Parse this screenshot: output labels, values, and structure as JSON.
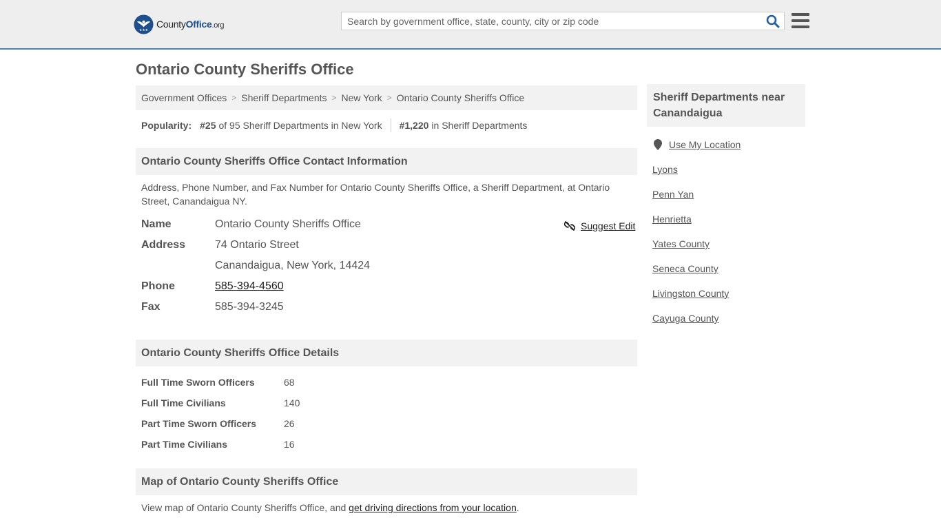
{
  "site": {
    "logo_text_part1": "County",
    "logo_text_part2": "Office",
    "logo_text_part3": ".org",
    "search_placeholder": "Search by government office, state, county, city or zip code",
    "brand_color": "#1f4e8c",
    "accent_border": "#4a83b8"
  },
  "page": {
    "title": "Ontario County Sheriffs Office"
  },
  "breadcrumb": [
    "Government Offices",
    "Sheriff Departments",
    "New York",
    "Ontario County Sheriffs Office"
  ],
  "popularity": {
    "label": "Popularity:",
    "rank_state": "#25",
    "rank_state_text": "of 95 Sheriff Departments in New York",
    "rank_overall": "#1,220",
    "rank_overall_text": "in Sheriff Departments"
  },
  "contact": {
    "heading": "Ontario County Sheriffs Office Contact Information",
    "description": "Address, Phone Number, and Fax Number for Ontario County Sheriffs Office, a Sheriff Department, at Ontario Street, Canandaigua NY.",
    "suggest_edit": "Suggest Edit",
    "name_label": "Name",
    "name_value": "Ontario County Sheriffs Office",
    "address_label": "Address",
    "address_line1": "74 Ontario Street",
    "address_line2": "Canandaigua, New York, 14424",
    "phone_label": "Phone",
    "phone_value": "585-394-4560",
    "fax_label": "Fax",
    "fax_value": "585-394-3245"
  },
  "details": {
    "heading": "Ontario County Sheriffs Office Details",
    "rows": [
      {
        "label": "Full Time Sworn Officers",
        "value": "68"
      },
      {
        "label": "Full Time Civilians",
        "value": "140"
      },
      {
        "label": "Part Time Sworn Officers",
        "value": "26"
      },
      {
        "label": "Part Time Civilians",
        "value": "16"
      }
    ]
  },
  "map": {
    "heading": "Map of Ontario County Sheriffs Office",
    "text_before": "View map of Ontario County Sheriffs Office, and ",
    "link_text": "get driving directions from your location",
    "text_after": "."
  },
  "sidebar": {
    "heading": "Sheriff Departments near Canandaigua",
    "use_location": "Use My Location",
    "links": [
      "Lyons",
      "Penn Yan",
      "Henrietta",
      "Yates County",
      "Seneca County",
      "Livingston County",
      "Cayuga County"
    ]
  }
}
